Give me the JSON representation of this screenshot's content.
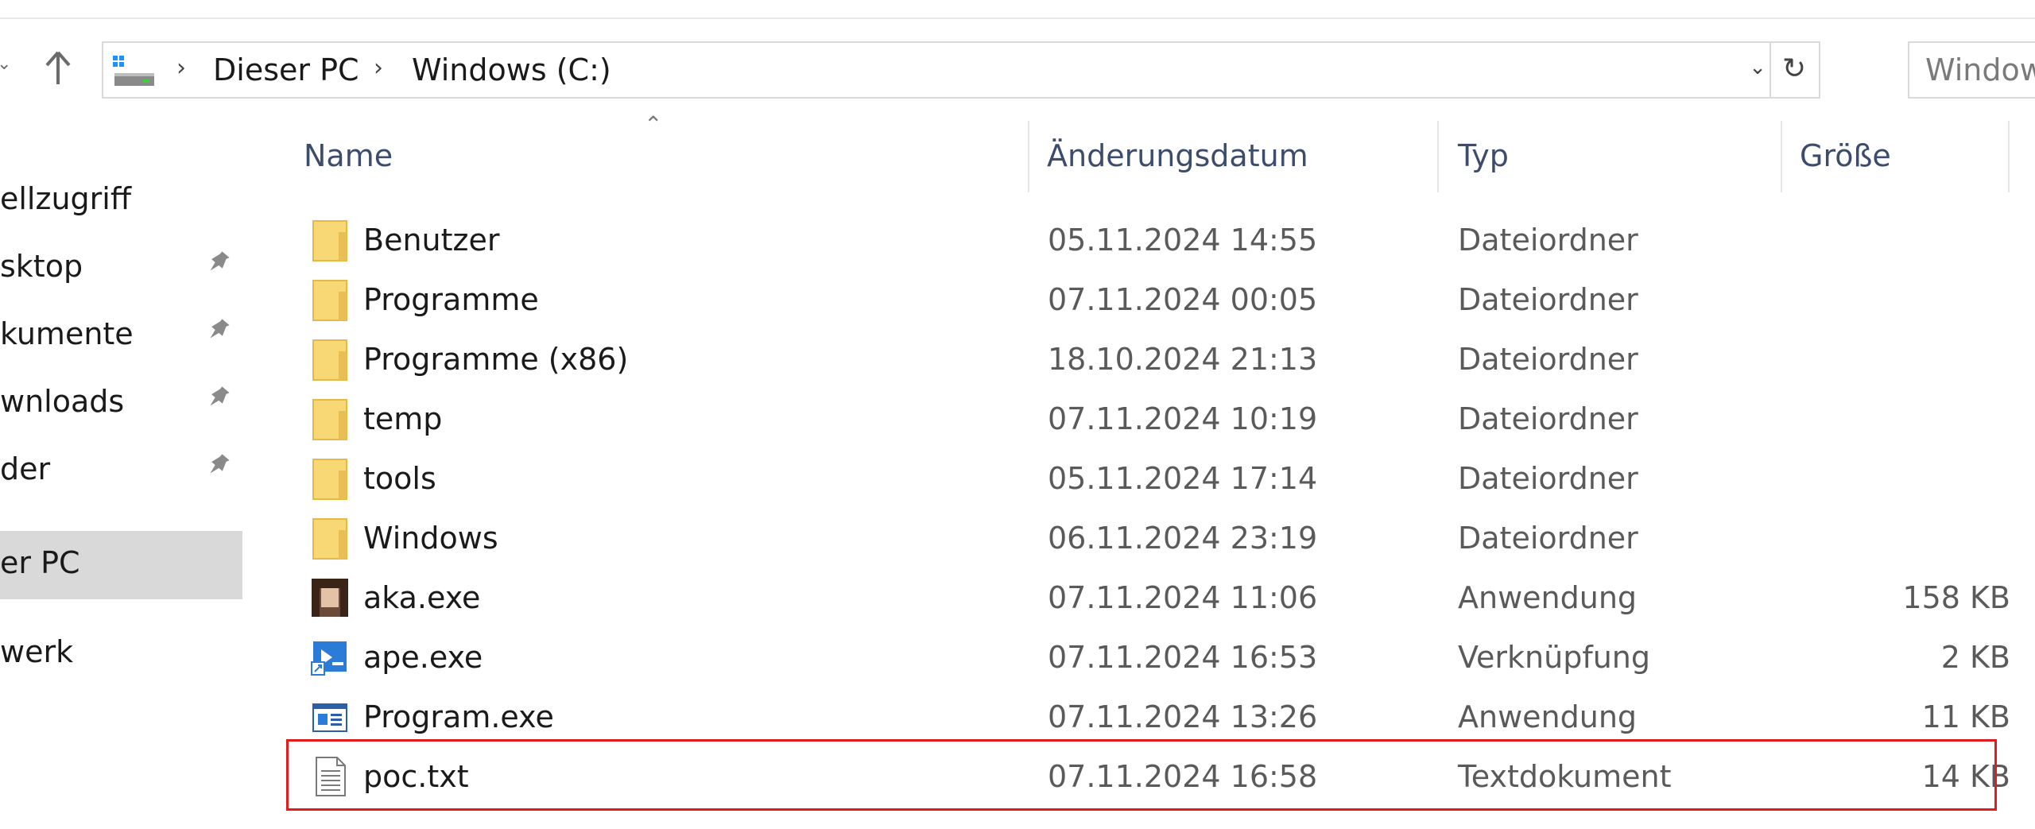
{
  "addressbar": {
    "crumbs": [
      "Dieser PC",
      "Windows (C:)"
    ]
  },
  "search": {
    "placeholder": "Windows"
  },
  "sidebar": {
    "items": [
      {
        "label": "ellzugriff",
        "pinned": false
      },
      {
        "label": "sktop",
        "pinned": true
      },
      {
        "label": "kumente",
        "pinned": true
      },
      {
        "label": "wnloads",
        "pinned": true
      },
      {
        "label": "der",
        "pinned": true
      },
      {
        "label": "er PC",
        "pinned": false,
        "selected": true
      },
      {
        "label": "werk",
        "pinned": false
      }
    ]
  },
  "columns": {
    "name": "Name",
    "date": "Änderungsdatum",
    "type": "Typ",
    "size": "Größe"
  },
  "files": [
    {
      "name": "Benutzer",
      "date": "05.11.2024 14:55",
      "type": "Dateiordner",
      "size": "",
      "icon": "folder-icon"
    },
    {
      "name": "Programme",
      "date": "07.11.2024 00:05",
      "type": "Dateiordner",
      "size": "",
      "icon": "folder-icon"
    },
    {
      "name": "Programme (x86)",
      "date": "18.10.2024 21:13",
      "type": "Dateiordner",
      "size": "",
      "icon": "folder-icon"
    },
    {
      "name": "temp",
      "date": "07.11.2024 10:19",
      "type": "Dateiordner",
      "size": "",
      "icon": "folder-icon"
    },
    {
      "name": "tools",
      "date": "05.11.2024 17:14",
      "type": "Dateiordner",
      "size": "",
      "icon": "folder-icon"
    },
    {
      "name": "Windows",
      "date": "06.11.2024 23:19",
      "type": "Dateiordner",
      "size": "",
      "icon": "folder-icon"
    },
    {
      "name": "aka.exe",
      "date": "07.11.2024 11:06",
      "type": "Anwendung",
      "size": "158 KB",
      "icon": "app-avatar-icon"
    },
    {
      "name": "ape.exe",
      "date": "07.11.2024 16:53",
      "type": "Verknüpfung",
      "size": "2 KB",
      "icon": "shortcut-icon"
    },
    {
      "name": "Program.exe",
      "date": "07.11.2024 13:26",
      "type": "Anwendung",
      "size": "11 KB",
      "icon": "window-app-icon"
    },
    {
      "name": "poc.txt",
      "date": "07.11.2024 16:58",
      "type": "Textdokument",
      "size": "14 KB",
      "icon": "text-document-icon"
    }
  ],
  "colors": {
    "highlight": "#e01c1c",
    "folder": "#f8d775",
    "selected_bg": "#d9d9d9",
    "header_text": "#3c4c6c"
  }
}
